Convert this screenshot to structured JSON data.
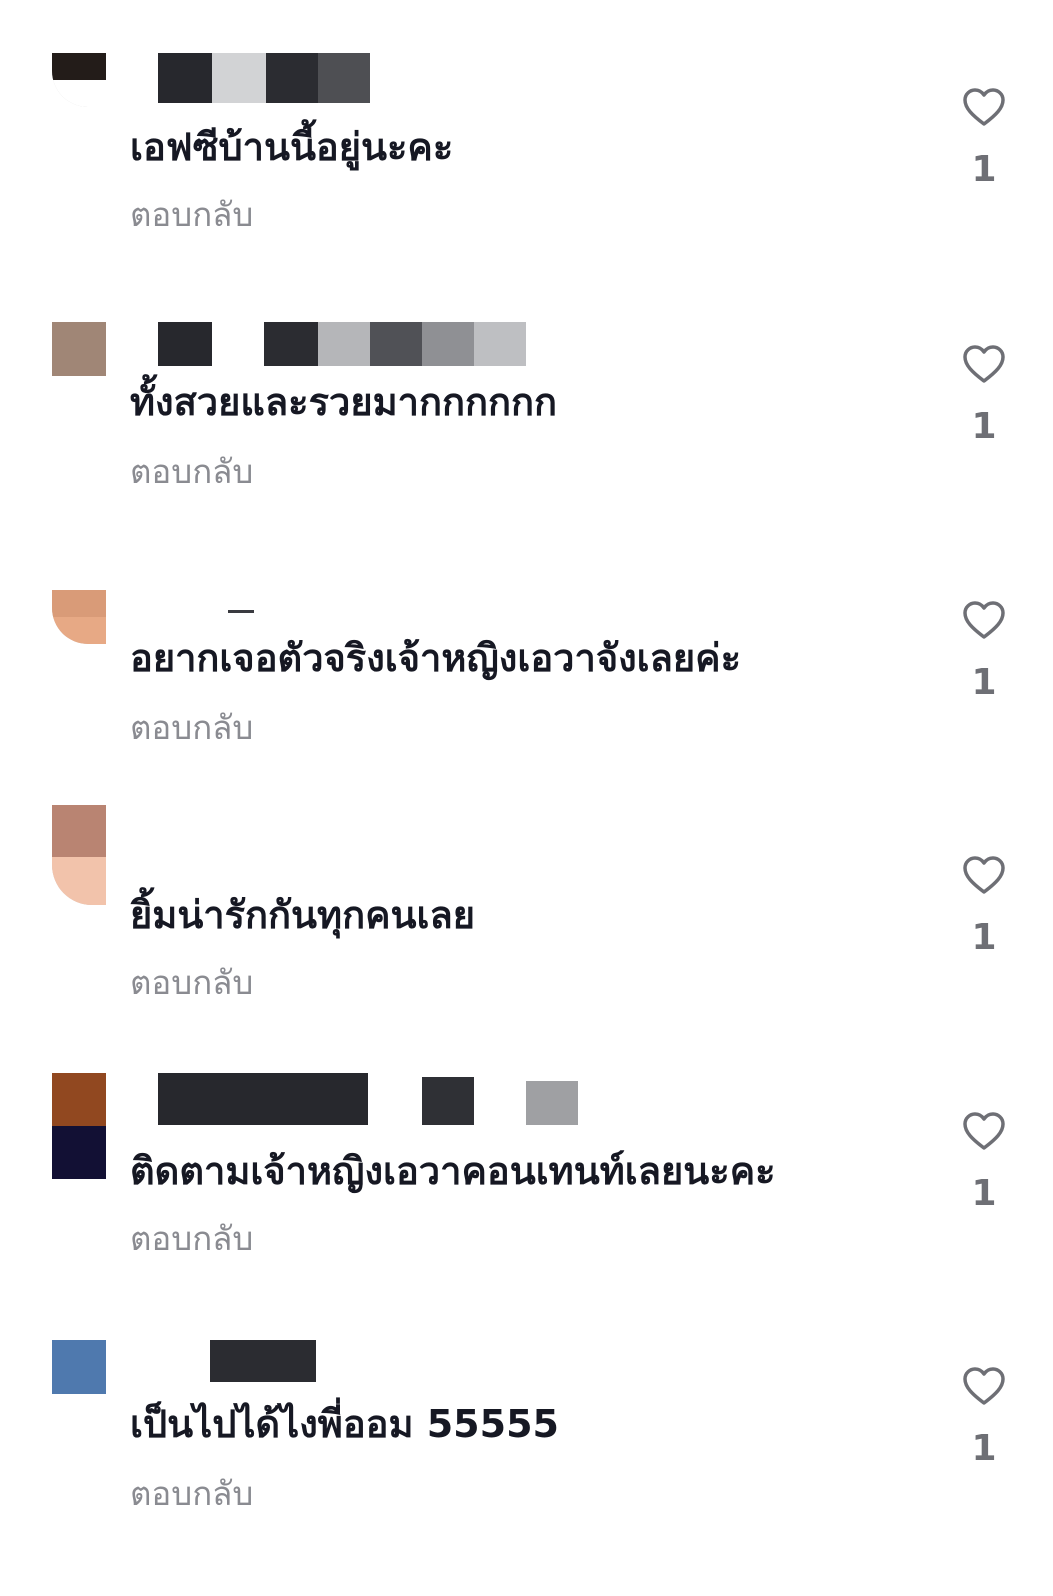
{
  "comments": [
    {
      "username": "",
      "text": "เอฟซีบ้านนี้อยู่นะคะ",
      "reply": "ตอบกลับ",
      "likes": "1",
      "avatar_colors": [
        "#231c19",
        "#ffffff"
      ]
    },
    {
      "username": "",
      "text": "ทั้งสวยและรวยมากกกกกก",
      "reply": "ตอบกลับ",
      "likes": "1",
      "avatar_colors": [
        "#a08676",
        "#a08676"
      ]
    },
    {
      "username": "",
      "text": "อยากเจอตัวจริงเจ้าหญิงเอวาจังเลยค่ะ",
      "reply": "ตอบกลับ",
      "likes": "1",
      "avatar_colors": [
        "#d99b78",
        "#e7a985"
      ]
    },
    {
      "username": "",
      "text": "ยิ้มน่ารักกันทุกคนเลย",
      "reply": "ตอบกลับ",
      "likes": "1",
      "avatar_colors": [
        "#b98472",
        "#f2c3ab"
      ]
    },
    {
      "username": "",
      "text": "ติดตามเจ้าหญิงเอวาคอนเทนท์เลยนะคะ",
      "reply": "ตอบกลับ",
      "likes": "1",
      "avatar_colors": [
        "#914820",
        "#121034"
      ]
    },
    {
      "username": "",
      "text": "เป็นไปได้ไงพี่ออม 55555",
      "reply": "ตอบกลับ",
      "likes": "1",
      "avatar_colors": [
        "#4f79ae",
        "#ffffff"
      ]
    }
  ],
  "icons": {
    "like": "heart-outline-icon"
  },
  "colors": {
    "text": "#161823",
    "secondary": "#8a8b91",
    "like_count": "#6e6f75",
    "heart_stroke": "#6e6f75"
  }
}
